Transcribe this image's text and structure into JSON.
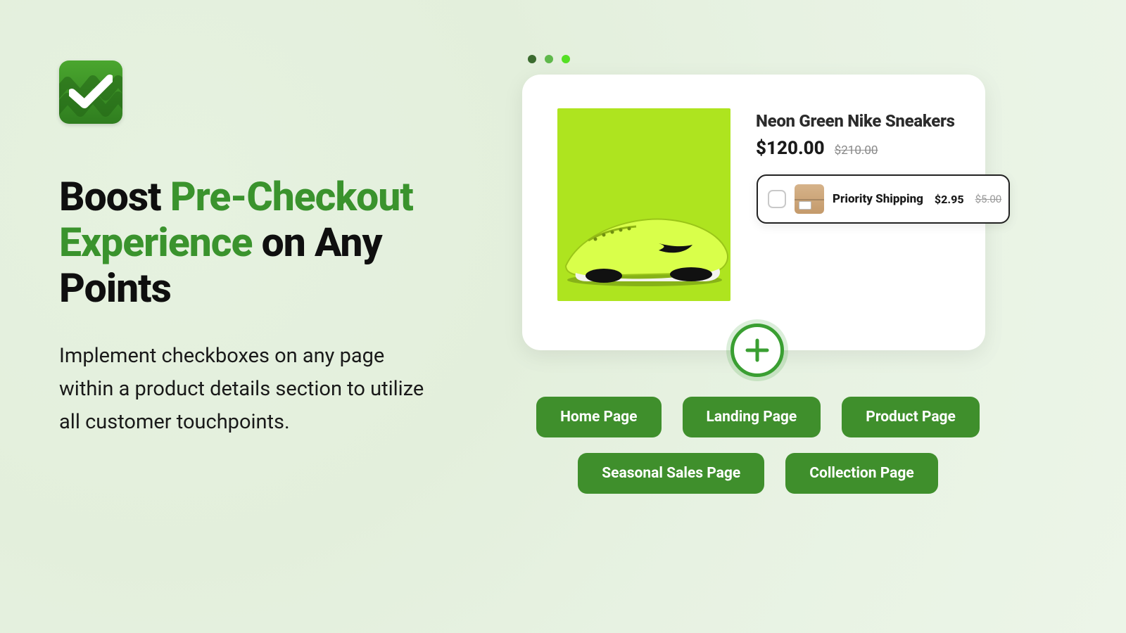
{
  "left": {
    "headline_part1": "Boost ",
    "headline_accent": "Pre-Checkout Experience",
    "headline_part2": " on Any Points",
    "subtext": "Implement checkboxes on any page within a product details section to utilize all customer touchpoints."
  },
  "product": {
    "title": "Neon Green Nike Sneakers",
    "price": "$120.00",
    "compare_at": "$210.00"
  },
  "upsell": {
    "label": "Priority Shipping",
    "price": "$2.95",
    "compare_at": "$5.00"
  },
  "pages": [
    "Home Page",
    "Landing Page",
    "Product Page",
    "Seasonal Sales Page",
    "Collection Page"
  ]
}
